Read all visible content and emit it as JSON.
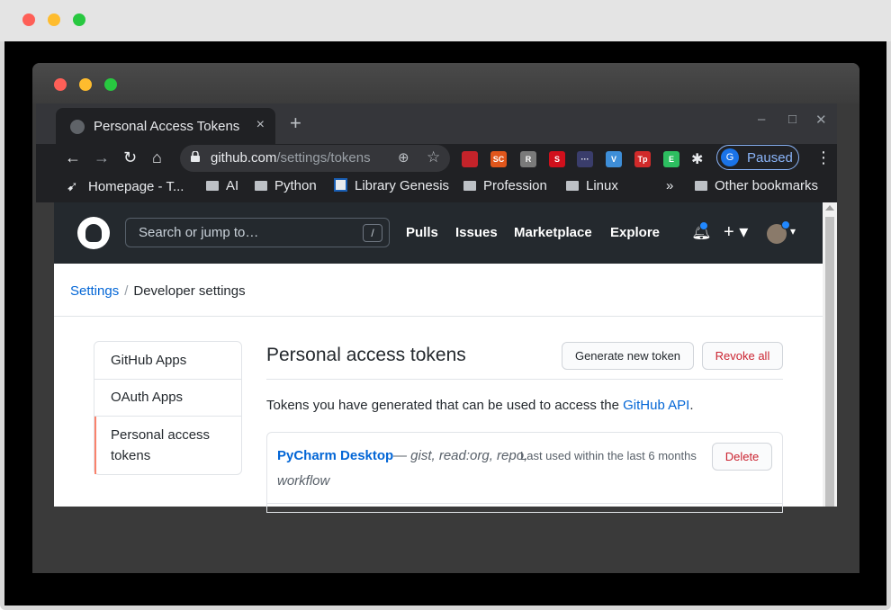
{
  "browser": {
    "tab_title": "Personal Access Tokens",
    "tab_close": "×",
    "new_tab": "+",
    "url_host": "github.com",
    "url_path": "/settings/tokens",
    "profile_initial": "G",
    "profile_status": "Paused",
    "extensions": [
      {
        "name": "ublock-icon",
        "label": "",
        "color": "#c4232a"
      },
      {
        "name": "soundcloud-icon",
        "label": "SC",
        "color": "#e0561b"
      },
      {
        "name": "reader-icon",
        "label": "R",
        "color": "#7a7a7a"
      },
      {
        "name": "s-extension-icon",
        "label": "S",
        "color": "#d0101c"
      },
      {
        "name": "dots-extension-icon",
        "label": "···",
        "color": "#3a3d6b"
      },
      {
        "name": "vivaldi-icon",
        "label": "V",
        "color": "#3e8ed8"
      },
      {
        "name": "tp-extension-icon",
        "label": "Tp",
        "color": "#d02a2a"
      },
      {
        "name": "evernote-icon",
        "label": "E",
        "color": "#2dbe60"
      }
    ],
    "bookmarks": [
      {
        "label": "Homepage - T...",
        "type": "site"
      },
      {
        "label": "AI",
        "type": "folder"
      },
      {
        "label": "Python",
        "type": "folder"
      },
      {
        "label": "Library Genesis",
        "type": "site"
      },
      {
        "label": "Profession",
        "type": "folder"
      },
      {
        "label": "Linux",
        "type": "folder"
      }
    ],
    "bookmarks_overflow": "»",
    "other_bookmarks": "Other bookmarks"
  },
  "github": {
    "search_placeholder": "Search or jump to…",
    "search_shortcut": "/",
    "nav": [
      "Pulls",
      "Issues",
      "Marketplace",
      "Explore"
    ],
    "plus": "+ ▾",
    "avatar_caret": "▾"
  },
  "breadcrumb": {
    "settings": "Settings",
    "separator": "/",
    "current": "Developer settings"
  },
  "sidebar": {
    "items": [
      "GitHub Apps",
      "OAuth Apps",
      "Personal access",
      "tokens"
    ]
  },
  "main": {
    "title": "Personal access tokens",
    "generate_button": "Generate new token",
    "revoke_button": "Revoke all",
    "description_prefix": "Tokens you have generated that can be used to access the",
    "description_link": "GitHub API",
    "description_suffix": "."
  },
  "tokens": [
    {
      "name": "PyCharm Desktop",
      "scopes_line1": "— gist, read:org, repo,",
      "scopes_line2": "workflow",
      "last_used": "Last used within the last 6 months",
      "delete_label": "Delete"
    }
  ],
  "colors": {
    "accent": "#0366d6",
    "danger": "#cb2431",
    "header_bg": "#24292e",
    "active_indicator": "#f9826c"
  }
}
